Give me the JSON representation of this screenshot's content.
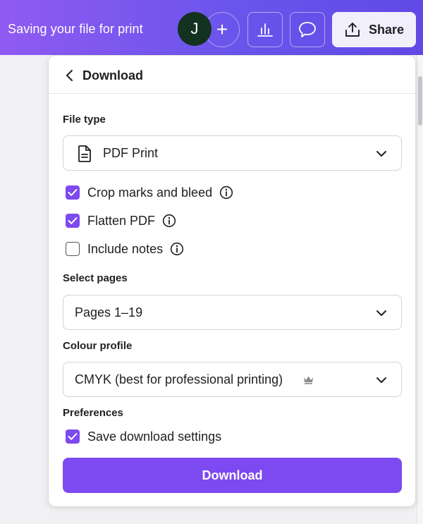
{
  "header": {
    "status_text": "Saving your file for print",
    "avatar_initial": "J",
    "add_symbol": "+",
    "share_label": "Share",
    "icons": [
      "add-icon",
      "insights-chart-icon",
      "comment-icon",
      "share-upload-icon"
    ]
  },
  "panel": {
    "title": "Download",
    "file_type": {
      "label": "File type",
      "value": "PDF Print",
      "icon": "document-icon"
    },
    "options": [
      {
        "label": "Crop marks and bleed",
        "checked": true,
        "has_info": true
      },
      {
        "label": "Flatten PDF",
        "checked": true,
        "has_info": true
      },
      {
        "label": "Include notes",
        "checked": false,
        "has_info": true
      }
    ],
    "select_pages": {
      "label": "Select pages",
      "value": "Pages 1–19"
    },
    "colour_profile": {
      "label": "Colour profile",
      "value": "CMYK (best for professional printing)",
      "badge_icon": "crown-icon"
    },
    "preferences": {
      "label": "Preferences",
      "save_settings_label": "Save download settings",
      "save_settings_checked": true
    },
    "download_button_label": "Download"
  },
  "colors": {
    "accent": "#7d49f0",
    "topbar_start": "#8f5af2",
    "topbar_end": "#6149e6",
    "avatar_bg": "#13321f"
  }
}
